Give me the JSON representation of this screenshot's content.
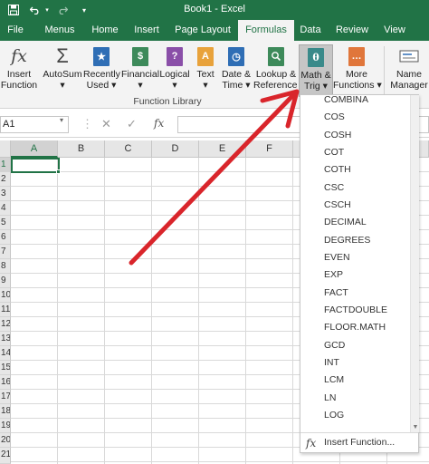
{
  "window": {
    "title": "Book1 - Excel",
    "colors": {
      "brand": "#217346",
      "ribbon": "#f3f3f3",
      "annotation": "#d9252b"
    }
  },
  "qat": {
    "icons": [
      "save-icon",
      "undo-icon",
      "redo-icon",
      "customize-icon"
    ]
  },
  "tabs": [
    {
      "label": "File"
    },
    {
      "label": "Menus"
    },
    {
      "label": "Home"
    },
    {
      "label": "Insert"
    },
    {
      "label": "Page Layout"
    },
    {
      "label": "Formulas",
      "active": true
    },
    {
      "label": "Data"
    },
    {
      "label": "Review"
    },
    {
      "label": "View"
    }
  ],
  "ribbon": {
    "buttons": [
      {
        "line1": "Insert",
        "line2": "Function"
      },
      {
        "line1": "AutoSum",
        "line2": "▾"
      },
      {
        "line1": "Recently",
        "line2": "Used ▾"
      },
      {
        "line1": "Financial",
        "line2": "▾"
      },
      {
        "line1": "Logical",
        "line2": "▾"
      },
      {
        "line1": "Text",
        "line2": "▾"
      },
      {
        "line1": "Date &",
        "line2": "Time ▾"
      },
      {
        "line1": "Lookup &",
        "line2": "Reference ▾"
      },
      {
        "line1": "Math &",
        "line2": "Trig ▾",
        "active": true
      },
      {
        "line1": "More",
        "line2": "Functions ▾"
      },
      {
        "line1": "Name",
        "line2": "Manager"
      }
    ],
    "group_label": "Function Library",
    "icon_glyphs": {
      "insert_function": "fx",
      "autosum": "Σ",
      "recently_used": "★",
      "financial": "$",
      "logical": "?",
      "text": "A",
      "date_time": "◷",
      "lookup": "🔍",
      "math_trig": "θ",
      "more": "…"
    }
  },
  "formula_bar": {
    "name_box": "A1",
    "fx_label": "fx",
    "cancel_glyph": "✕",
    "enter_glyph": "✓"
  },
  "grid": {
    "columns": [
      "A",
      "B",
      "C",
      "D",
      "E",
      "F"
    ],
    "rows": [
      "1",
      "2",
      "3",
      "4",
      "5",
      "6",
      "7",
      "8",
      "9",
      "10",
      "11",
      "12",
      "13",
      "14",
      "15",
      "16",
      "17",
      "18",
      "19",
      "20",
      "21"
    ],
    "active_cell": "A1"
  },
  "menu": {
    "items": [
      "COMBINA",
      "COS",
      "COSH",
      "COT",
      "COTH",
      "CSC",
      "CSCH",
      "DECIMAL",
      "DEGREES",
      "EVEN",
      "EXP",
      "FACT",
      "FACTDOUBLE",
      "FLOOR.MATH",
      "GCD",
      "INT",
      "LCM",
      "LN",
      "LOG"
    ],
    "footer_label": "Insert Function...",
    "footer_icon": "fx"
  }
}
